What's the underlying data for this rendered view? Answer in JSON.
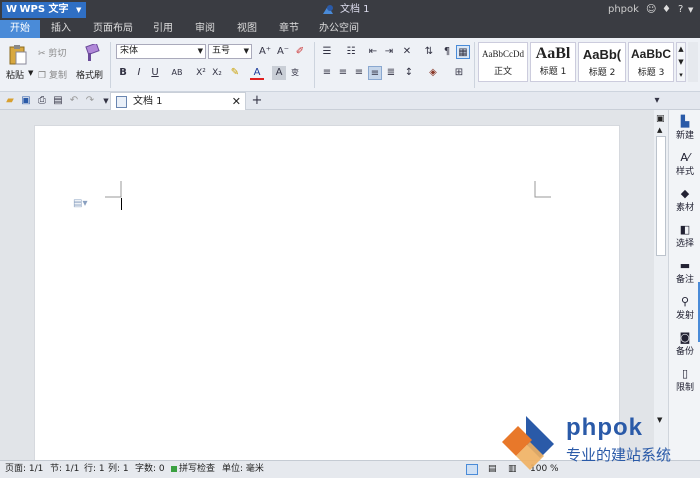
{
  "titlebar": {
    "app_name": "WPS 文字",
    "doc_title": "文档 1",
    "user": "phpok",
    "help": "?"
  },
  "tabs": [
    {
      "label": "开始"
    },
    {
      "label": "插入"
    },
    {
      "label": "页面布局"
    },
    {
      "label": "引用"
    },
    {
      "label": "审阅"
    },
    {
      "label": "视图"
    },
    {
      "label": "章节"
    },
    {
      "label": "办公空间"
    }
  ],
  "ribbon": {
    "paste": "粘贴",
    "cut": "剪切",
    "copy": "复制",
    "format_painter": "格式刷",
    "font_name": "宋体",
    "font_size": "五号",
    "styles": [
      {
        "preview": "AaBbCcDd",
        "label": "正文"
      },
      {
        "preview": "AaBl",
        "label": "标题 1"
      },
      {
        "preview": "AaBb(",
        "label": "标题 2"
      },
      {
        "preview": "AaBbC",
        "label": "标题 3"
      }
    ]
  },
  "doctab": {
    "label": "文档 1"
  },
  "side_panel": [
    {
      "label": "新建",
      "icon": "new-doc-icon"
    },
    {
      "label": "样式",
      "icon": "style-icon"
    },
    {
      "label": "素材",
      "icon": "material-icon"
    },
    {
      "label": "选择",
      "icon": "select-icon"
    },
    {
      "label": "备注",
      "icon": "comment-icon"
    },
    {
      "label": "发射",
      "icon": "send-icon"
    },
    {
      "label": "备份",
      "icon": "backup-icon"
    },
    {
      "label": "限制",
      "icon": "restrict-icon"
    }
  ],
  "status": {
    "page": "页面: 1/1",
    "section": "节: 1/1",
    "row": "行: 1",
    "col": "列: 1",
    "words": "字数: 0",
    "spell": "拼写检查",
    "unit": "单位: 毫米",
    "zoom": "100 %"
  },
  "watermark": {
    "brand": "phpok",
    "slogan": "专业的建站系统"
  },
  "colors": {
    "accent": "#4a8bd8",
    "titlebar": "#3a3c42",
    "watermark_blue": "#2a5aa8",
    "watermark_orange": "#e8782a"
  }
}
